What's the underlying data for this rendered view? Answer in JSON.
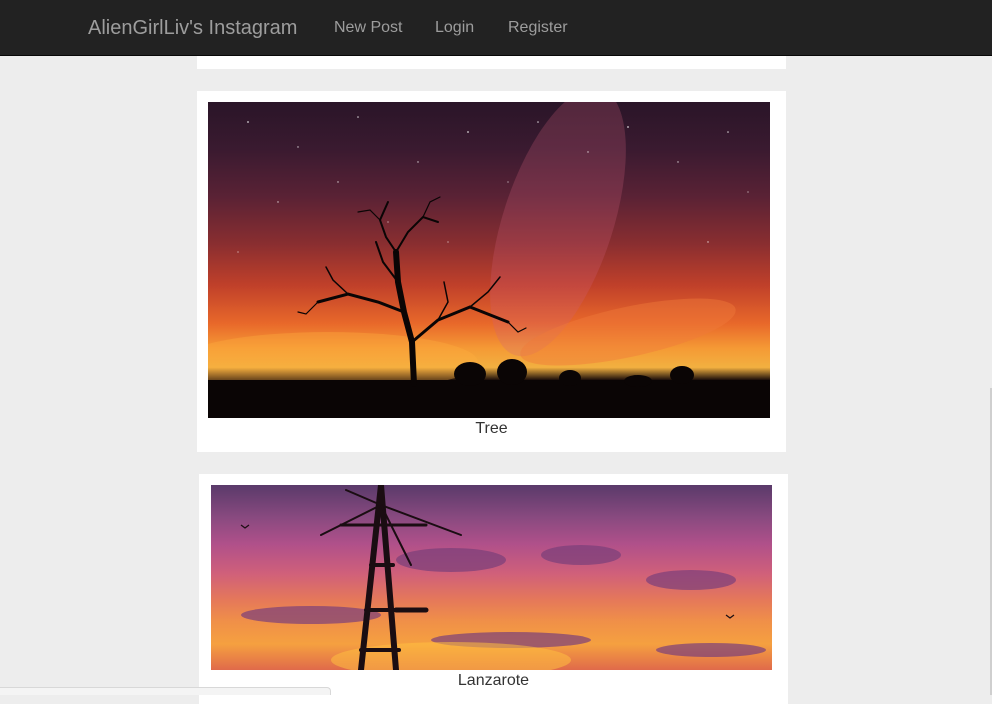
{
  "navbar": {
    "brand": "AlienGirlLiv's Instagram",
    "links": {
      "new_post": "New Post",
      "login": "Login",
      "register": "Register"
    }
  },
  "posts": [
    {
      "caption": "Tree",
      "image": "sunset-tree-milky-way-photo"
    },
    {
      "caption": "Lanzarote",
      "image": "windmill-sunset-photo"
    }
  ],
  "colors": {
    "navbar_bg": "#222222",
    "nav_text": "#9d9d9d",
    "page_bg": "#ededed",
    "card_bg": "#ffffff",
    "caption_text": "#333333"
  }
}
